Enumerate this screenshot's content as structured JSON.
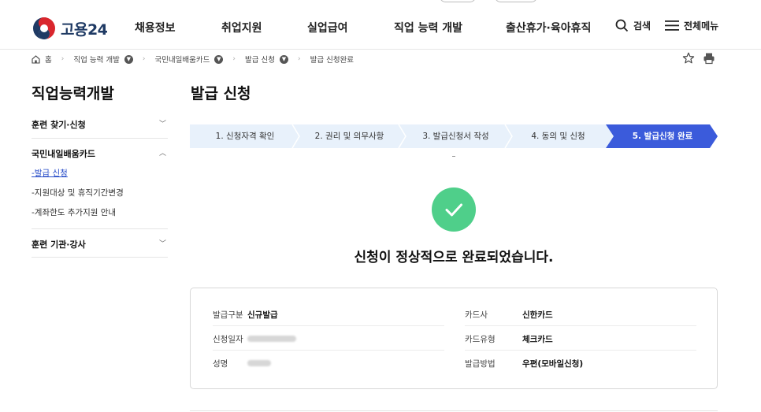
{
  "header": {
    "logo_text": "고용24",
    "nav": [
      "채용정보",
      "취업지원",
      "실업급여",
      "직업 능력 개발",
      "출산휴가·육아휴직"
    ],
    "search_label": "검색",
    "all_menu_label": "전체메뉴"
  },
  "breadcrumb": {
    "home": "홈",
    "items": [
      "직업 능력 개발",
      "국민내일배움카드",
      "발급 신청",
      "발급 신청완료"
    ]
  },
  "sidebar": {
    "title": "직업능력개발",
    "groups": [
      {
        "label": "훈련 찾기·신청",
        "expanded": false
      },
      {
        "label": "국민내일배움카드",
        "expanded": true,
        "items": [
          {
            "label": "발급 신청",
            "active": true
          },
          {
            "label": "지원대상 및 휴직기간변경",
            "active": false
          },
          {
            "label": "계좌한도 추가지원 안내",
            "active": false
          }
        ]
      },
      {
        "label": "훈련 기관·강사",
        "expanded": false
      }
    ]
  },
  "main": {
    "title": "발급 신청",
    "steps": [
      {
        "label": "1. 신청자격 확인",
        "active": false
      },
      {
        "label": "2. 권리 및 의무사항",
        "active": false
      },
      {
        "label": "3. 발급신청서 작성",
        "active": false
      },
      {
        "label": "4. 동의 및 신청",
        "active": false
      },
      {
        "label": "5. 발급신청 완료",
        "active": true
      }
    ],
    "success_message": "신청이 정상적으로 완료되었습니다.",
    "info_left": [
      {
        "label": "발급구분",
        "value": "신규발급"
      },
      {
        "label": "신청일자",
        "value": ""
      },
      {
        "label": "성명",
        "value": ""
      }
    ],
    "info_right": [
      {
        "label": "카드사",
        "value": "신한카드"
      },
      {
        "label": "카드유형",
        "value": "체크카드"
      },
      {
        "label": "발급방법",
        "value": "우편(모바일신청)"
      }
    ]
  },
  "colors": {
    "step_inactive": "#e8f1fb",
    "step_active": "#3b5bdb",
    "success": "#4fcf8a",
    "link_active": "#2349c7",
    "logo_navy": "#1f3a64"
  }
}
